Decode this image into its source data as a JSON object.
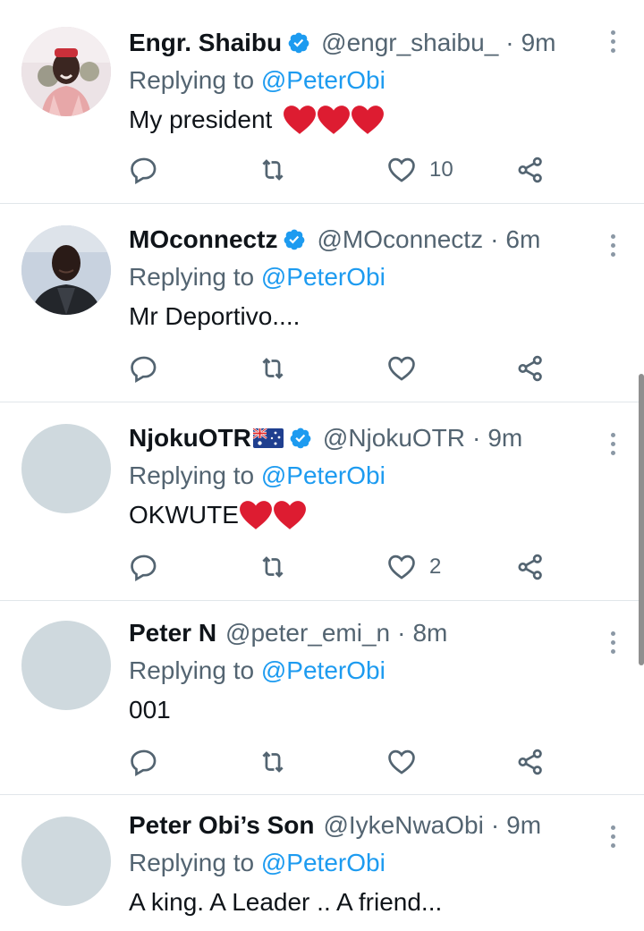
{
  "tweets": [
    {
      "name": "Engr. Shaibu",
      "verified": true,
      "handle": "@engr_shaibu_",
      "separator": "·",
      "time": "9m",
      "replying_prefix": "Replying to",
      "replying_to": "@PeterObi",
      "text": "My president",
      "emoji_hearts": 3,
      "likes": "10",
      "avatar": "photo"
    },
    {
      "name": "MOconnectz",
      "verified": true,
      "handle": "@MOconnectz",
      "separator": "·",
      "time": "6m",
      "replying_prefix": "Replying to",
      "replying_to": "@PeterObi",
      "text": "Mr Deportivo....",
      "emoji_hearts": 0,
      "likes": "",
      "avatar": "photo"
    },
    {
      "name": "NjokuOTR",
      "verified": true,
      "flag": "australia-flag",
      "handle": "@NjokuOTR",
      "separator": "·",
      "time": "9m",
      "replying_prefix": "Replying to",
      "replying_to": "@PeterObi",
      "text": "OKWUTE",
      "emoji_hearts": 2,
      "likes": "2",
      "avatar": "placeholder"
    },
    {
      "name": "Peter N",
      "verified": false,
      "handle": "@peter_emi_n",
      "separator": "·",
      "time": "8m",
      "replying_prefix": "Replying to",
      "replying_to": "@PeterObi",
      "text": "001",
      "emoji_hearts": 0,
      "likes": "",
      "avatar": "placeholder"
    },
    {
      "name": "Peter Obi’s Son",
      "verified": false,
      "handle": "@IykeNwaObi",
      "separator": "·",
      "time": "9m",
      "replying_prefix": "Replying to",
      "replying_to": "@PeterObi",
      "text": "A king. A Leader .. A friend...",
      "emoji_hearts": 0,
      "likes": "",
      "avatar": "placeholder"
    }
  ],
  "colors": {
    "accent": "#1d9bf0",
    "muted": "#536471",
    "heart_red": "#dd1c31",
    "avatar_placeholder": "#cfd9de"
  },
  "icons": [
    "reply-icon",
    "retweet-icon",
    "like-icon",
    "share-icon",
    "verified-badge-icon",
    "more-icon"
  ]
}
